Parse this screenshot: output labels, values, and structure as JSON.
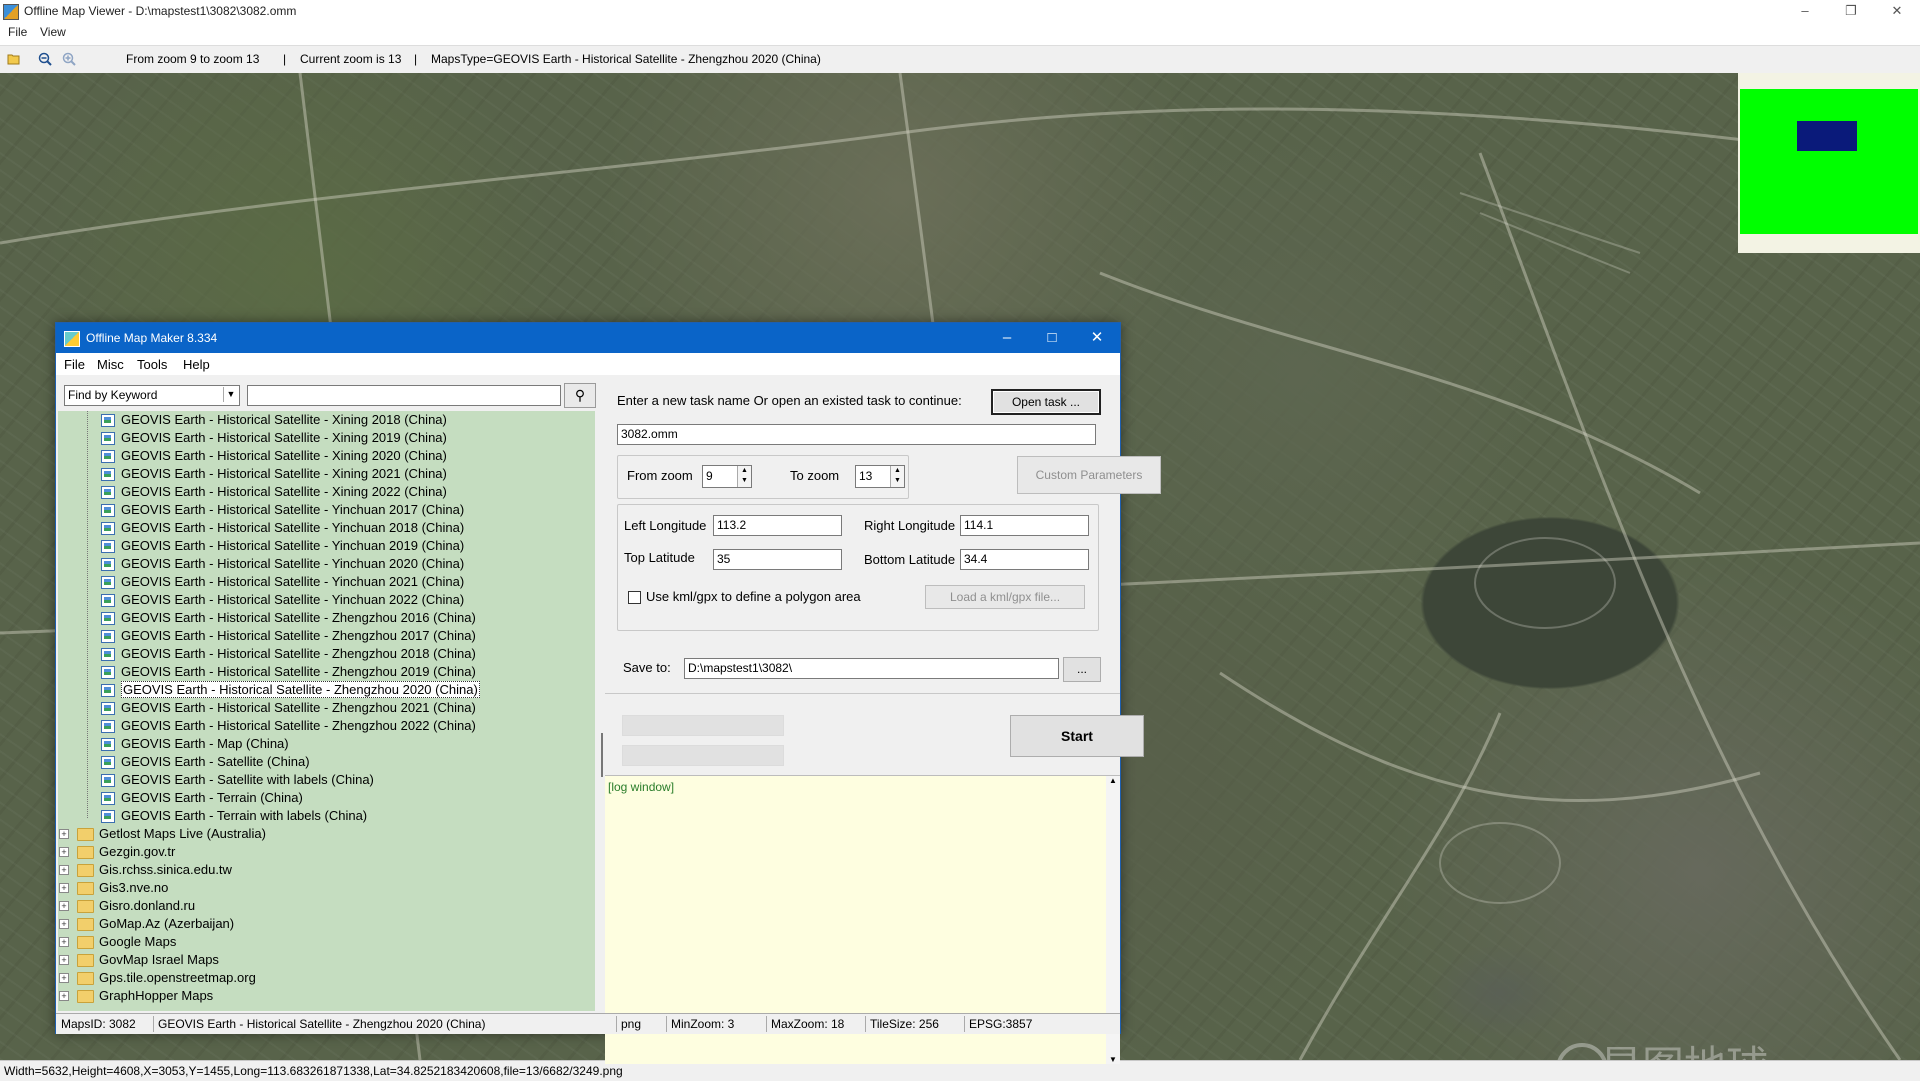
{
  "viewer": {
    "title": "Offline Map Viewer - D:\\mapstest1\\3082\\3082.omm",
    "menu": [
      "File",
      "View"
    ],
    "toolbar": {
      "zoom_range": "From zoom 9 to zoom 13",
      "current_zoom": "Current zoom is 13",
      "maps_type": "MapsType=GEOVIS Earth - Historical Satellite - Zhengzhou 2020 (China)"
    },
    "status": "Width=5632,Height=4608,X=3053,Y=1455,Long=113.683261871338,Lat=34.8252183420608,file=13/6682/3249.png",
    "watermark": "星图地球"
  },
  "dialog": {
    "title": "Offline Map Maker 8.334",
    "menu": [
      "File",
      "Misc",
      "Tools",
      "Help"
    ],
    "find_mode": "Find by Keyword",
    "find_query": "",
    "tree": {
      "leaves": [
        "GEOVIS Earth - Historical Satellite - Xining 2018 (China)",
        "GEOVIS Earth - Historical Satellite - Xining 2019 (China)",
        "GEOVIS Earth - Historical Satellite - Xining 2020 (China)",
        "GEOVIS Earth - Historical Satellite - Xining 2021 (China)",
        "GEOVIS Earth - Historical Satellite - Xining 2022 (China)",
        "GEOVIS Earth - Historical Satellite - Yinchuan 2017 (China)",
        "GEOVIS Earth - Historical Satellite - Yinchuan 2018 (China)",
        "GEOVIS Earth - Historical Satellite - Yinchuan 2019 (China)",
        "GEOVIS Earth - Historical Satellite - Yinchuan 2020 (China)",
        "GEOVIS Earth - Historical Satellite - Yinchuan 2021 (China)",
        "GEOVIS Earth - Historical Satellite - Yinchuan 2022 (China)",
        "GEOVIS Earth - Historical Satellite - Zhengzhou 2016 (China)",
        "GEOVIS Earth - Historical Satellite - Zhengzhou 2017 (China)",
        "GEOVIS Earth - Historical Satellite - Zhengzhou 2018 (China)",
        "GEOVIS Earth - Historical Satellite - Zhengzhou 2019 (China)",
        "GEOVIS Earth - Historical Satellite - Zhengzhou 2020 (China)",
        "GEOVIS Earth - Historical Satellite - Zhengzhou 2021 (China)",
        "GEOVIS Earth - Historical Satellite - Zhengzhou 2022 (China)",
        "GEOVIS Earth - Map (China)",
        "GEOVIS Earth - Satellite (China)",
        "GEOVIS Earth - Satellite with labels (China)",
        "GEOVIS Earth - Terrain (China)",
        "GEOVIS Earth - Terrain with labels (China)"
      ],
      "selected_leaf": "GEOVIS Earth - Historical Satellite - Zhengzhou 2020 (China)",
      "folders": [
        "Getlost Maps Live (Australia)",
        "Gezgin.gov.tr",
        "Gis.rchss.sinica.edu.tw",
        "Gis3.nve.no",
        "Gisro.donland.ru",
        "GoMap.Az (Azerbaijan)",
        "Google Maps",
        "GovMap Israel Maps",
        "Gps.tile.openstreetmap.org",
        "GraphHopper Maps"
      ]
    },
    "task": {
      "prompt": "Enter a new task name Or open an existed task to continue:",
      "open_button": "Open task ...",
      "name": "3082.omm"
    },
    "zoom": {
      "from_label": "From zoom",
      "from_value": "9",
      "to_label": "To zoom",
      "to_value": "13",
      "custom_button": "Custom Parameters"
    },
    "bounds": {
      "left_lon_label": "Left Longitude",
      "left_lon": "113.2",
      "right_lon_label": "Right Longitude",
      "right_lon": "114.1",
      "top_lat_label": "Top Latitude",
      "top_lat": "35",
      "bottom_lat_label": "Bottom Latitude",
      "bottom_lat": "34.4",
      "kml_checkbox_label": "Use kml/gpx to define a polygon area",
      "kml_checked": false,
      "kml_button": "Load a kml/gpx file..."
    },
    "save": {
      "label": "Save to:",
      "path": "D:\\mapstest1\\3082\\",
      "browse": "..."
    },
    "start_button": "Start",
    "log": "[log window]",
    "status": {
      "maps_id": "MapsID: 3082",
      "map_name": "GEOVIS Earth - Historical Satellite - Zhengzhou 2020 (China)",
      "format": "png",
      "min_zoom": "MinZoom: 3",
      "max_zoom": "MaxZoom: 18",
      "tile_size": "TileSize: 256",
      "epsg": "EPSG:3857"
    }
  }
}
